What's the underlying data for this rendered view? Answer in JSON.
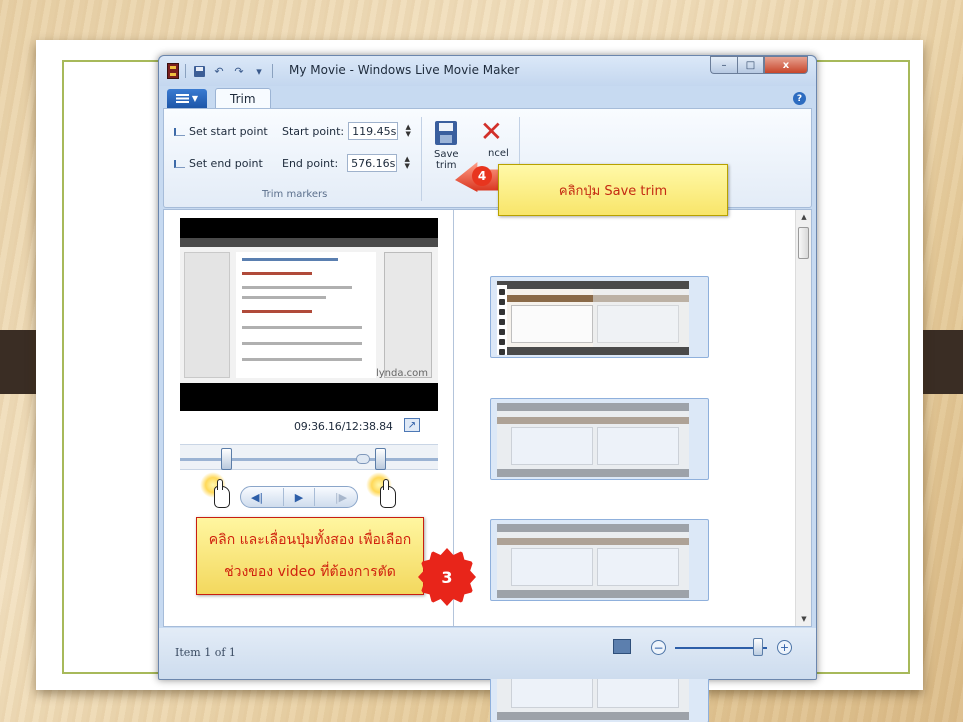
{
  "window": {
    "title": "My Movie - Windows Live Movie Maker",
    "controls": {
      "minimize": "–",
      "maximize": "□",
      "close": "x"
    }
  },
  "qat_icons": [
    "save-icon",
    "undo-icon",
    "redo-icon",
    "customize-qat-icon"
  ],
  "tabs": {
    "active": "Trim"
  },
  "ribbon": {
    "trim_markers": {
      "set_start_label": "Set start point",
      "set_end_label": "Set end point",
      "start_point_label": "Start point:",
      "start_point_value": "119.45s",
      "end_point_label": "End point:",
      "end_point_value": "576.16s",
      "group_label": "Trim markers"
    },
    "save_trim": {
      "line1": "Save",
      "line2": "trim"
    },
    "cancel": {
      "line1": "ncel"
    }
  },
  "preview": {
    "timecode": "09:36.16/12:38.84",
    "watermark": "lynda.com"
  },
  "playback": {
    "previous_frame": "◀|",
    "play": "▶",
    "next_frame": "|▶"
  },
  "trim_slider": {
    "start_fraction": 0.157,
    "end_fraction": 0.756,
    "playhead_fraction": 0.7
  },
  "status": {
    "text": "Item 1 of 1",
    "zoom_fraction": 0.9
  },
  "annotations": {
    "step4_number": "4",
    "step4_text": "คลิกปุ่ม Save trim",
    "step3_number": "3",
    "step3_line1": "คลิก และเลื่อนปุ่มทั้งสอง เพื่อเลือก",
    "step3_line2": "ช่วงของ video ที่ต้องการตัด"
  },
  "colors": {
    "callout_yellow": "#f8e56a",
    "callout_text": "#c42a12",
    "badge_red": "#e8251a",
    "ribbon_blue": "#2d5ea8"
  }
}
